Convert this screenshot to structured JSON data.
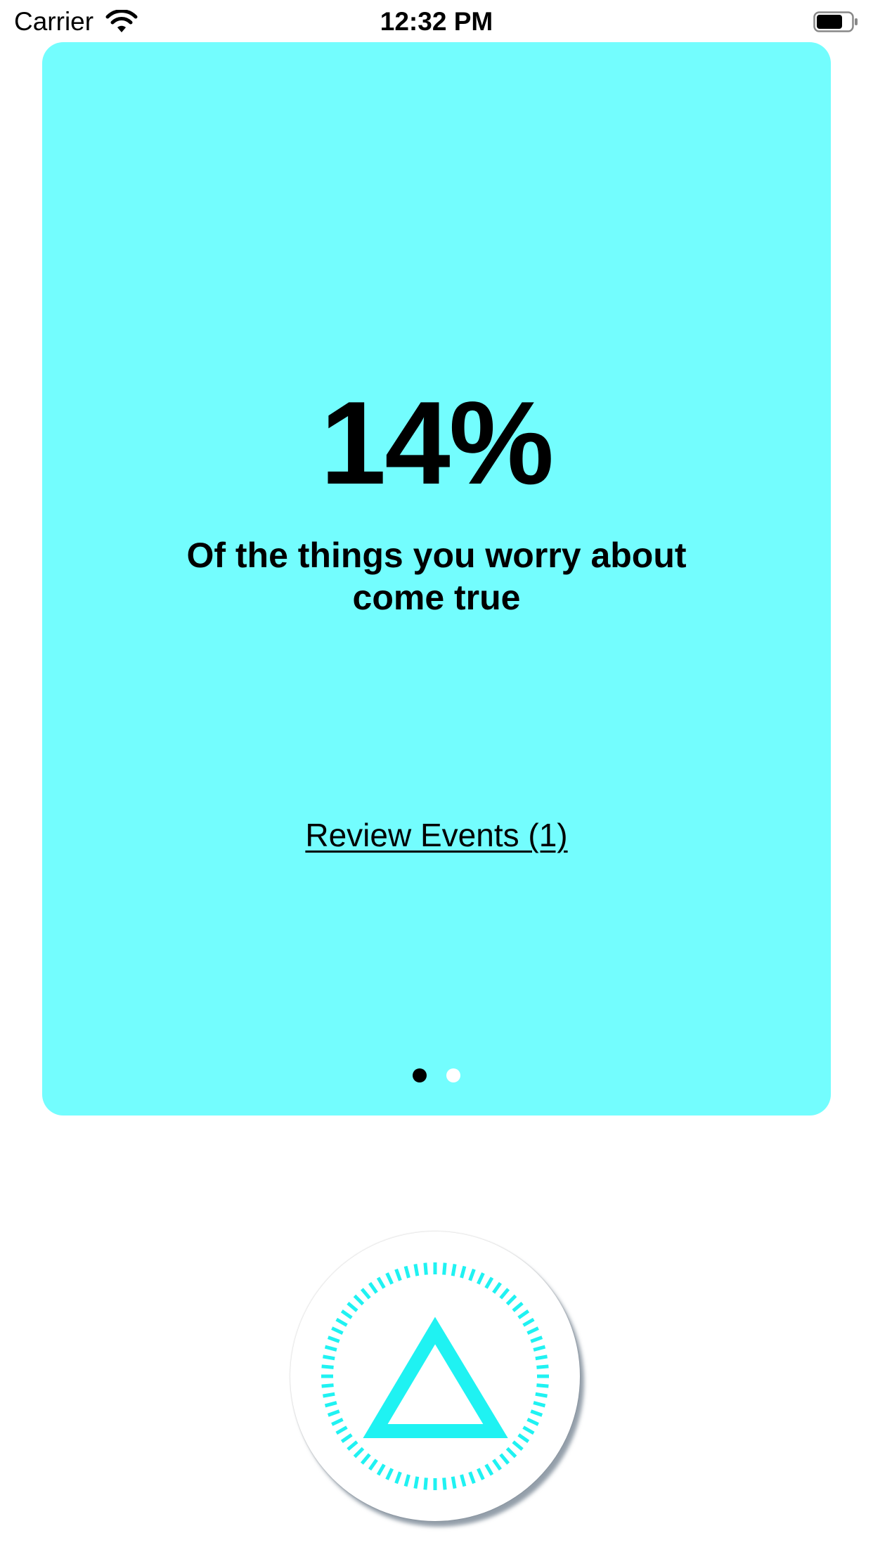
{
  "status_bar": {
    "carrier": "Carrier",
    "time": "12:32 PM",
    "icons": [
      "wifi-icon",
      "battery-icon"
    ]
  },
  "card": {
    "background_color": "#73fdfe",
    "stat_value": "14%",
    "stat_caption_line1": "Of the things you worry about",
    "stat_caption_line2": "come true",
    "review_link_label": "Review Events (1)",
    "page_indicator": {
      "count": 2,
      "current": 1
    }
  },
  "action_button": {
    "icon": "triangle-icon",
    "ring": "dashed-ring",
    "accent_color": "#1ff2f2"
  }
}
